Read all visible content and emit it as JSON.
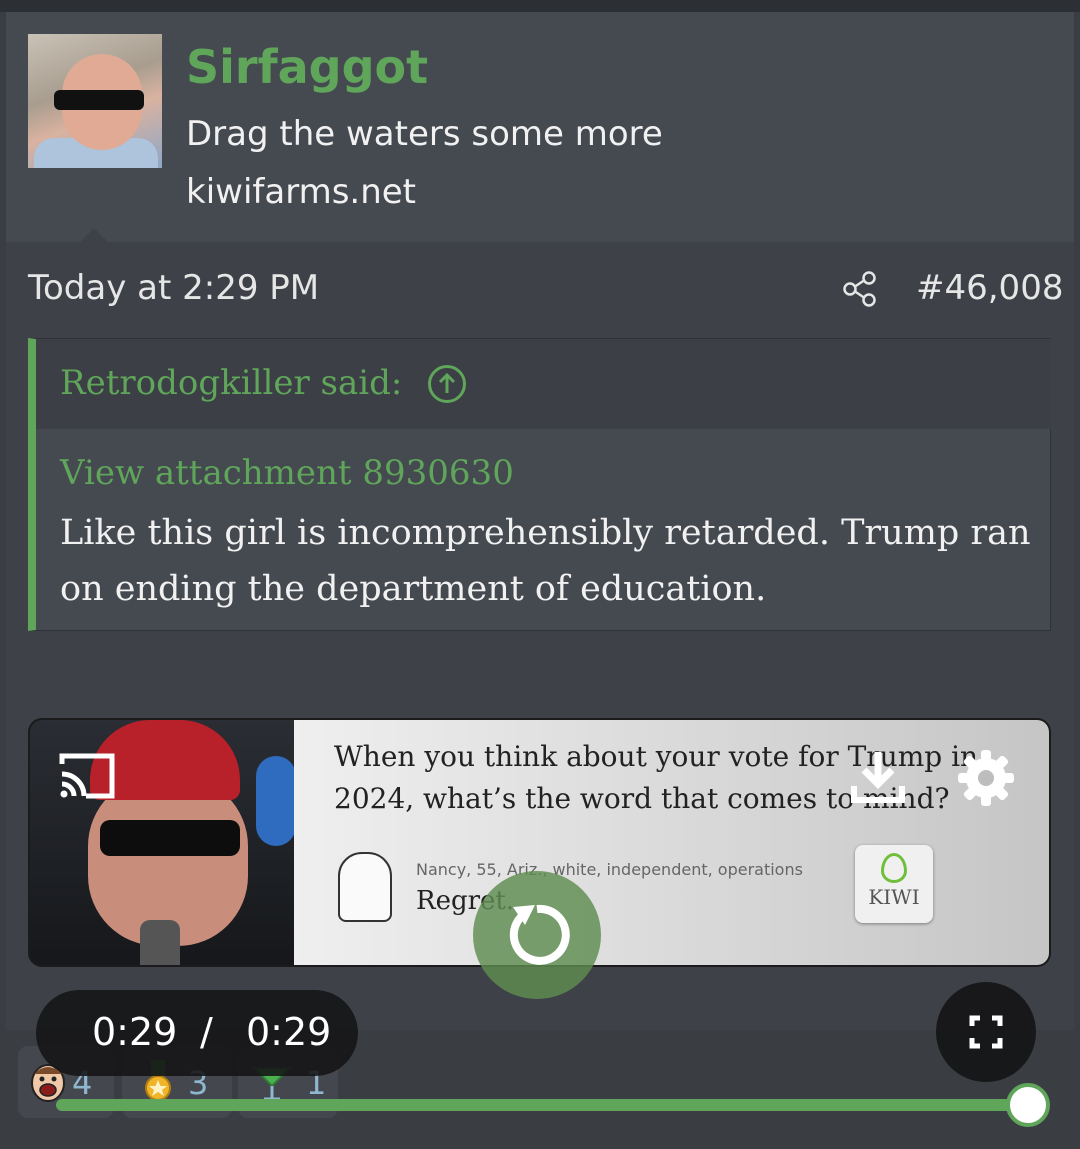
{
  "post": {
    "username": "Sirfaggot",
    "user_title": "Drag the waters some more",
    "user_site": "kiwifarms.net",
    "timestamp": "Today at 2:29 PM",
    "post_number": "#46,008"
  },
  "quote": {
    "author": "Retrodogkiller said:",
    "attachment_link": "View attachment 8930630",
    "text": "Like this girl is incomprehensibly retarded. Trump ran on ending the department of education."
  },
  "video": {
    "frame_question": "When you think about your vote for Trump in 2024, what’s the word that comes to mind?",
    "frame_meta": "Nancy, 55, Ariz., white, independent, operations",
    "frame_answer": "Regret.",
    "watermark": "KIWI",
    "current_time": "0:29",
    "separator": "/",
    "duration": "0:29",
    "progress_fraction": 1.0
  },
  "reactions": [
    {
      "icon": "laughing-face-icon",
      "count": "4"
    },
    {
      "icon": "medal-icon",
      "count": "3"
    },
    {
      "icon": "cocktail-glass-icon",
      "count": "1"
    }
  ],
  "colors": {
    "accent_green": "#5fa65a",
    "background": "#3e4248",
    "header_bg": "#454950"
  }
}
